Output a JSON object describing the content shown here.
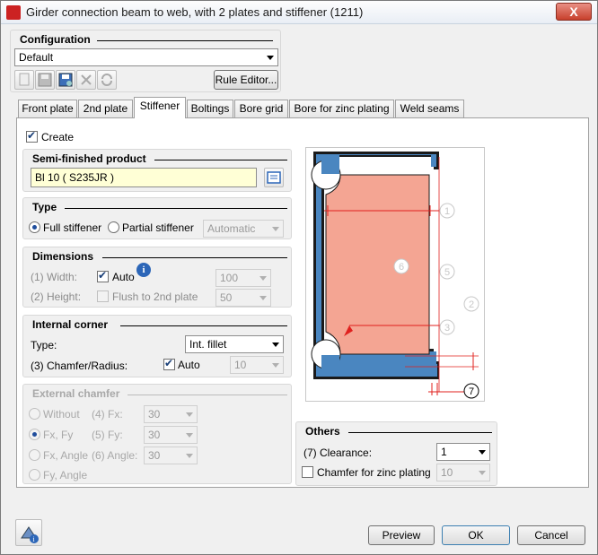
{
  "window": {
    "title": "Girder connection beam to web, with 2 plates and stiffener (1211)",
    "close_label": "X"
  },
  "configuration": {
    "title": "Configuration",
    "selected": "Default",
    "rule_editor_label": "Rule Editor..."
  },
  "tabs": [
    {
      "label": "Front plate"
    },
    {
      "label": "2nd plate"
    },
    {
      "label": "Stiffener"
    },
    {
      "label": "Boltings"
    },
    {
      "label": "Bore grid"
    },
    {
      "label": "Bore for zinc plating"
    },
    {
      "label": "Weld seams"
    }
  ],
  "active_tab": "Stiffener",
  "create": {
    "label": "Create",
    "checked": true
  },
  "semi": {
    "title": "Semi-finished product",
    "value": "Bl 10  ( S235JR )"
  },
  "type": {
    "title": "Type",
    "full_label": "Full stiffener",
    "partial_label": "Partial stiffener",
    "mode": "Automatic"
  },
  "dimensions": {
    "title": "Dimensions",
    "width_label": "(1) Width:",
    "auto_label": "Auto",
    "width_value": "100",
    "height_label": "(2) Height:",
    "flush_label": "Flush to 2nd plate",
    "height_value": "50"
  },
  "internal_corner": {
    "title": "Internal corner",
    "type_label": "Type:",
    "type_value": "Int. fillet",
    "chamfer_label": "(3) Chamfer/Radius:",
    "auto_label": "Auto",
    "value": "10"
  },
  "external_chamfer": {
    "title": "External chamfer",
    "without_label": "Without",
    "fx_label": "(4) Fx:",
    "fx_value": "30",
    "fxfy_label": "Fx, Fy",
    "fy_label": "(5) Fy:",
    "fy_value": "30",
    "fxangle_label": "Fx, Angle",
    "angle_label": "(6) Angle:",
    "angle_value": "30",
    "fyangle_label": "Fy, Angle"
  },
  "others": {
    "title": "Others",
    "clearance_label": "(7) Clearance:",
    "clearance_value": "1",
    "chamfer_zinc_label": "Chamfer for zinc plating",
    "chamfer_zinc_value": "10"
  },
  "diagram": {
    "labels": [
      "1",
      "2",
      "3",
      "5",
      "6",
      "7"
    ]
  },
  "footer": {
    "preview": "Preview",
    "ok": "OK",
    "cancel": "Cancel"
  },
  "colors": {
    "accent": "#2c66b8",
    "beam": "#4a86c0",
    "plate": "#f4a593",
    "dim_line": "#e0201e"
  }
}
